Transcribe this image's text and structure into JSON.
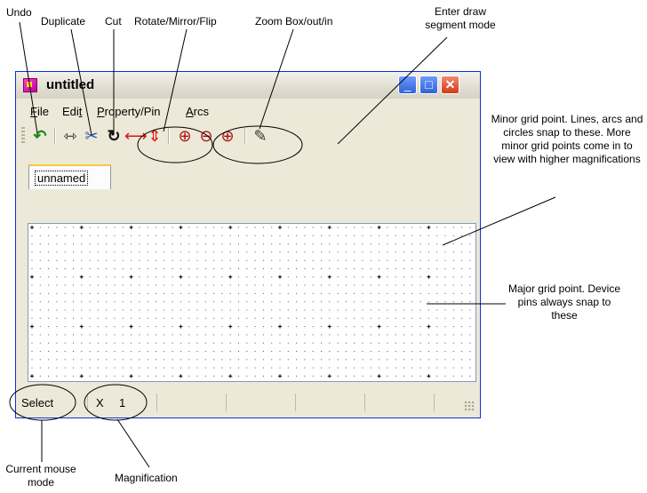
{
  "annotations": {
    "undo": "Undo",
    "duplicate": "Duplicate",
    "cut": "Cut",
    "rotate": "Rotate/Mirror/Flip",
    "zoom": "Zoom Box/out/in",
    "draw": "Enter draw segment mode",
    "minor_grid": "Minor grid point. Lines, arcs and circles snap to these. More minor grid points come in to view with higher magnifications",
    "major_grid": "Major grid point. Device pins always snap to these",
    "mouse_mode": "Current mouse mode",
    "magnification": "Magnification"
  },
  "window": {
    "title": "untitled",
    "min_glyph": "_",
    "max_glyph": "□",
    "close_glyph": "✕"
  },
  "menu": {
    "file_u": "F",
    "file_rest": "ile",
    "edit_a": "Edi",
    "edit_u": "t",
    "prop_u": "P",
    "prop_rest": "roperty/Pin",
    "arcs_u": "A",
    "arcs_rest": "rcs"
  },
  "toolbar": {
    "undo_glyph": "↶",
    "duplicate_glyph": "⇿",
    "cut_glyph": "✂",
    "rotate_glyph": "↻",
    "mirror_glyph": "⟷",
    "flip_glyph": "⇕",
    "zoom_box_glyph": "⊕",
    "zoom_out_glyph": "⊖",
    "zoom_in_glyph": "⊕",
    "draw_glyph": "✎"
  },
  "tab": {
    "label": "unnamed"
  },
  "status": {
    "mode": "Select",
    "zoom_prefix": "X",
    "zoom_value": "1"
  },
  "colors": {
    "accent_tab": "#ffc83c",
    "title_bar": "#e3e0d4",
    "close_button": "#d43a16"
  }
}
